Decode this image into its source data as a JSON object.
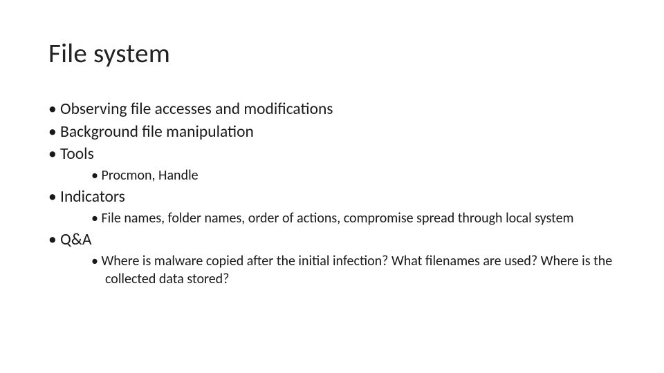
{
  "title": "File system",
  "bullets": [
    {
      "text": "Observing file accesses and modifications",
      "children": []
    },
    {
      "text": "Background file manipulation",
      "children": []
    },
    {
      "text": "Tools",
      "children": [
        {
          "text": "Procmon, Handle"
        }
      ]
    },
    {
      "text": "Indicators",
      "children": [
        {
          "text": "File names, folder names, order of actions, compromise spread through local system"
        }
      ]
    },
    {
      "text": "Q&A",
      "children": [
        {
          "text": "Where is malware copied after the initial infection? What filenames are used? Where is the collected data stored?"
        }
      ]
    }
  ]
}
